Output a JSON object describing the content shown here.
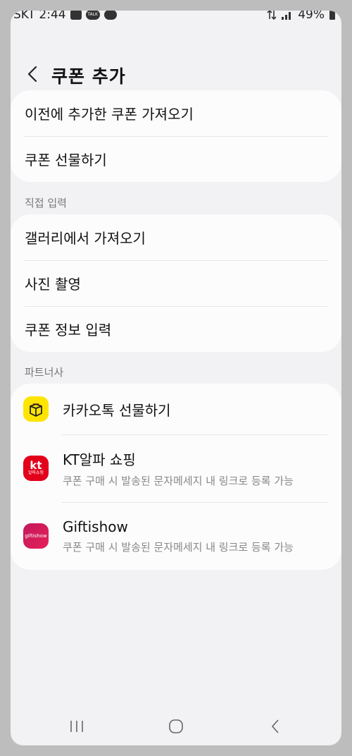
{
  "status_bar": {
    "carrier_time": "SKT 2:44",
    "talk_badge": "TALK",
    "battery": "49%"
  },
  "header": {
    "title": "쿠폰 추가"
  },
  "group1": {
    "items": [
      {
        "label": "이전에 추가한 쿠폰 가져오기"
      },
      {
        "label": "쿠폰 선물하기"
      }
    ]
  },
  "direct_input": {
    "section_label": "직접 입력",
    "items": [
      {
        "label": "갤러리에서 가져오기"
      },
      {
        "label": "사진 촬영"
      },
      {
        "label": "쿠폰 정보 입력"
      }
    ]
  },
  "partners": {
    "section_label": "파트너사",
    "items": [
      {
        "name": "카카오톡 선물하기",
        "subtitle": "",
        "icon": "kakao-gift-icon",
        "icon_color": "#FEE500"
      },
      {
        "name": "KT알파 쇼핑",
        "subtitle": "쿠폰 구매 시 발송된 문자메세지 내 링크로 등록 가능",
        "icon": "kt-alpha-icon",
        "icon_color": "#E2001A",
        "icon_text_top": "kt",
        "icon_text_bottom": "알파쇼핑"
      },
      {
        "name": "Giftishow",
        "subtitle": "쿠폰 구매 시 발송된 문자메세지 내 링크로 등록 가능",
        "icon": "giftishow-icon",
        "icon_color": "#E6205A",
        "icon_text": "giftishow"
      }
    ]
  },
  "nav": {
    "recent": "recent-apps-icon",
    "home": "home-icon",
    "back": "back-icon"
  }
}
